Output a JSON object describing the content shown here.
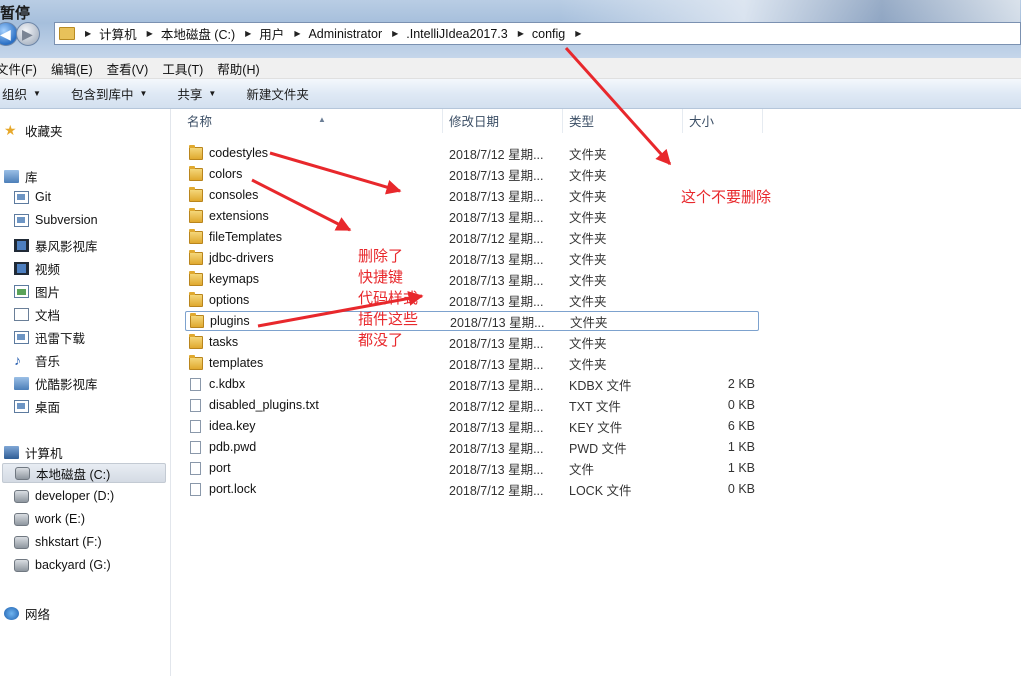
{
  "window": {
    "title": "暂停"
  },
  "address_bar": {
    "crumbs": [
      "计算机",
      "本地磁盘 (C:)",
      "用户",
      "Administrator",
      ".IntelliJIdea2017.3",
      "config"
    ]
  },
  "menu": [
    "文件(F)",
    "编辑(E)",
    "查看(V)",
    "工具(T)",
    "帮助(H)"
  ],
  "toolbar": {
    "organize": "组织",
    "include_in_library": "包含到库中",
    "share": "共享",
    "new_folder": "新建文件夹"
  },
  "navigation": {
    "favorites": "收藏夹",
    "libraries": "库",
    "library_items": [
      "Git",
      "Subversion",
      "暴风影视库",
      "视频",
      "图片",
      "文档",
      "迅雷下载",
      "音乐",
      "优酷影视库",
      "桌面"
    ],
    "computer": "计算机",
    "drives": [
      "本地磁盘 (C:)",
      "developer (D:)",
      "work (E:)",
      "shkstart (F:)",
      "backyard (G:)"
    ],
    "selected_drive": "本地磁盘 (C:)",
    "network": "网络"
  },
  "columns": {
    "name": "名称",
    "date": "修改日期",
    "type": "类型",
    "size": "大小"
  },
  "files": [
    {
      "name": "codestyles",
      "date": "2018/7/12 星期...",
      "type": "文件夹",
      "size": "",
      "kind": "folder"
    },
    {
      "name": "colors",
      "date": "2018/7/13 星期...",
      "type": "文件夹",
      "size": "",
      "kind": "folder"
    },
    {
      "name": "consoles",
      "date": "2018/7/13 星期...",
      "type": "文件夹",
      "size": "",
      "kind": "folder"
    },
    {
      "name": "extensions",
      "date": "2018/7/13 星期...",
      "type": "文件夹",
      "size": "",
      "kind": "folder"
    },
    {
      "name": "fileTemplates",
      "date": "2018/7/12 星期...",
      "type": "文件夹",
      "size": "",
      "kind": "folder"
    },
    {
      "name": "jdbc-drivers",
      "date": "2018/7/13 星期...",
      "type": "文件夹",
      "size": "",
      "kind": "folder"
    },
    {
      "name": "keymaps",
      "date": "2018/7/13 星期...",
      "type": "文件夹",
      "size": "",
      "kind": "folder"
    },
    {
      "name": "options",
      "date": "2018/7/13 星期...",
      "type": "文件夹",
      "size": "",
      "kind": "folder"
    },
    {
      "name": "plugins",
      "date": "2018/7/13 星期...",
      "type": "文件夹",
      "size": "",
      "kind": "folder",
      "selected": true
    },
    {
      "name": "tasks",
      "date": "2018/7/13 星期...",
      "type": "文件夹",
      "size": "",
      "kind": "folder"
    },
    {
      "name": "templates",
      "date": "2018/7/13 星期...",
      "type": "文件夹",
      "size": "",
      "kind": "folder"
    },
    {
      "name": "c.kdbx",
      "date": "2018/7/13 星期...",
      "type": "KDBX 文件",
      "size": "2 KB",
      "kind": "file"
    },
    {
      "name": "disabled_plugins.txt",
      "date": "2018/7/12 星期...",
      "type": "TXT 文件",
      "size": "0 KB",
      "kind": "file"
    },
    {
      "name": "idea.key",
      "date": "2018/7/13 星期...",
      "type": "KEY 文件",
      "size": "6 KB",
      "kind": "file"
    },
    {
      "name": "pdb.pwd",
      "date": "2018/7/13 星期...",
      "type": "PWD 文件",
      "size": "1 KB",
      "kind": "file"
    },
    {
      "name": "port",
      "date": "2018/7/13 星期...",
      "type": "文件",
      "size": "1 KB",
      "kind": "file"
    },
    {
      "name": "port.lock",
      "date": "2018/7/12 星期...",
      "type": "LOCK 文件",
      "size": "0 KB",
      "kind": "file"
    }
  ],
  "annotations": {
    "deleted_note": "删除了\n快捷键\n代码样式\n插件这些\n都没了",
    "keep_note": "这个不要删除",
    "color": "#e8282c"
  }
}
